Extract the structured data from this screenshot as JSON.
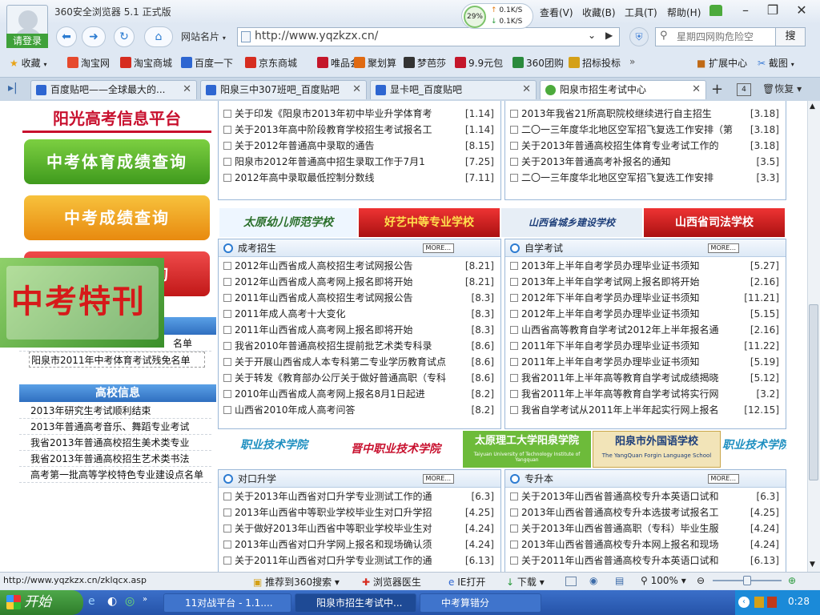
{
  "titlebar": {
    "login": "请登录",
    "title": "360安全浏览器 5.1 正式版",
    "speed": {
      "percent": "29%",
      "up": "0.1K/S",
      "down": "0.1K/S"
    },
    "menus": [
      "查看(V)",
      "收藏(B)",
      "工具(T)",
      "帮助(H)"
    ]
  },
  "nav": {
    "site_label": "网站名片",
    "url": "http://www.yqzkzx.cn/",
    "search_placeholder": "星期四网购危险空",
    "search_button": "搜"
  },
  "bookmarks": {
    "favorites": "收藏",
    "items": [
      "淘宝网",
      "淘宝商城",
      "百度一下",
      "京东商城",
      "唯品会",
      "聚划算",
      "梦芭莎",
      "9.9元包",
      "360团购",
      "招标投标"
    ],
    "colors": [
      "#e6492d",
      "#d62d20",
      "#2e66d1",
      "#d62d20",
      "#c4162a",
      "#e06a12",
      "#333333",
      "#c4162a",
      "#2a8a3c",
      "#d4a017"
    ],
    "extensions": "扩展中心",
    "screenshot": "截图"
  },
  "tabs": [
    {
      "title": "百度贴吧——全球最大的..."
    },
    {
      "title": "阳泉三中307班吧_百度贴吧"
    },
    {
      "title": "显卡吧_百度贴吧"
    },
    {
      "title": "阳泉市招生考试中心"
    }
  ],
  "tabbar": {
    "count": "4",
    "restore": "恢复"
  },
  "left": {
    "logo": "阳光高考信息平台",
    "promos": [
      "中考体育成绩查询",
      "中考成绩查询",
      "中考录取查询"
    ],
    "special": "中考特刊",
    "items_top": [
      "名单",
      "阳泉市2011年中考体育考试残免名单"
    ],
    "section_title": "高校信息",
    "items": [
      "2013年研究生考试顺利结束",
      "2013年普通高考音乐、舞蹈专业考试",
      "我省2013年普通高校招生美术类专业",
      "我省2013年普通高校招生艺术类书法",
      "高考第一批高等学校特色专业建设点名单"
    ]
  },
  "top_left_rows": [
    {
      "t": "关于印发《阳泉市2013年初中毕业升学体育考",
      "d": "[1.14]"
    },
    {
      "t": "关于2013年高中阶段教育学校招生考试报名工",
      "d": "[1.14]"
    },
    {
      "t": "关于2012年普通高中录取的通告",
      "d": "[8.15]"
    },
    {
      "t": "阳泉市2012年普通高中招生录取工作于7月1",
      "d": "[7.25]"
    },
    {
      "t": "2012年高中录取最低控制分数线",
      "d": "[7.11]"
    }
  ],
  "top_right_rows": [
    {
      "t": "2013年我省21所高职院校继续进行自主招生",
      "d": "[3.18]"
    },
    {
      "t": "二〇一三年度华北地区空军招飞复选工作安排（第",
      "d": "[3.18]"
    },
    {
      "t": "关于2013年普通高校招生体育专业考试工作的",
      "d": "[3.18]"
    },
    {
      "t": "关于2013年普通高考补报名的通知",
      "d": "[3.5]"
    },
    {
      "t": "二〇一三年度华北地区空军招飞复选工作安排",
      "d": "[3.3]"
    }
  ],
  "banners_1": [
    "太原幼儿师范学校",
    "好艺中等专业学校",
    "山西省城乡建设学校",
    "山西省司法学校"
  ],
  "panels": {
    "chengkao": {
      "title": "成考招生",
      "more": "MORE...",
      "rows": [
        {
          "t": "2012年山西省成人高校招生考试网报公告",
          "d": "[8.21]"
        },
        {
          "t": "2012年山西省成人高考网上报名即将开始",
          "d": "[8.21]"
        },
        {
          "t": "2011年山西省成人高校招生考试网报公告",
          "d": "[8.3]"
        },
        {
          "t": "2011年成人高考十大变化",
          "d": "[8.3]"
        },
        {
          "t": "2011年山西省成人高考网上报名即将开始",
          "d": "[8.3]"
        },
        {
          "t": "我省2010年普通高校招生提前批艺术类专科录",
          "d": "[8.6]"
        },
        {
          "t": "关于开展山西省成人本专科第二专业学历教育试点",
          "d": "[8.6]"
        },
        {
          "t": "关于转发《教育部办公厅关于做好普通高职（专科",
          "d": "[8.6]"
        },
        {
          "t": "2010年山西省成人高考网上报名8月1日起进",
          "d": "[8.2]"
        },
        {
          "t": "山西省2010年成人高考问答",
          "d": "[8.2]"
        }
      ]
    },
    "zikao": {
      "title": "自学考试",
      "more": "MORE...",
      "rows": [
        {
          "t": "2013年上半年自考学员办理毕业证书须知",
          "d": "[5.27]"
        },
        {
          "t": "2013年上半年自学考试网上报名即将开始",
          "d": "[2.16]"
        },
        {
          "t": "2012年下半年自考学员办理毕业证书须知",
          "d": "[11.21]"
        },
        {
          "t": "2012年上半年自考学员办理毕业证书须知",
          "d": "[5.15]"
        },
        {
          "t": "山西省高等教育自学考试2012年上半年报名通",
          "d": "[2.16]"
        },
        {
          "t": "2011年下半年自考学员办理毕业证书须知",
          "d": "[11.22]"
        },
        {
          "t": "2011年上半年自考学员办理毕业证书须知",
          "d": "[5.19]"
        },
        {
          "t": "我省2011年上半年高等教育自学考试成绩揭晓",
          "d": "[5.12]"
        },
        {
          "t": "我省2011年上半年高等教育自学考试将实行网",
          "d": "[3.2]"
        },
        {
          "t": "我省自学考试从2011年上半年起实行网上报名",
          "d": "[12.15]"
        }
      ]
    },
    "duikou": {
      "title": "对口升学",
      "more": "MORE...",
      "rows": [
        {
          "t": "关于2013年山西省对口升学专业测试工作的通",
          "d": "[6.3]"
        },
        {
          "t": "2013年山西省中等职业学校毕业生对口升学招",
          "d": "[4.25]"
        },
        {
          "t": "关于做好2013年山西省中等职业学校毕业生对",
          "d": "[4.24]"
        },
        {
          "t": "2013年山西省对口升学网上报名和现场确认须",
          "d": "[4.24]"
        },
        {
          "t": "关于2011年山西省对口升学专业测试工作的通",
          "d": "[6.13]"
        }
      ]
    },
    "zhuanshengben": {
      "title": "专升本",
      "more": "MORE...",
      "rows": [
        {
          "t": "关于2013年山西省普通高校专升本英语口试和",
          "d": "[6.3]"
        },
        {
          "t": "2013年山西省普通高校专升本选拔考试报名工",
          "d": "[4.25]"
        },
        {
          "t": "关于2013年山西省普通高职（专科）毕业生服",
          "d": "[4.24]"
        },
        {
          "t": "2013年山西省普通高校专升本网上报名和现场",
          "d": "[4.24]"
        },
        {
          "t": "关于2011年山西省普通高校专升本英语口试和",
          "d": "[6.13]"
        }
      ]
    }
  },
  "banners_2": [
    "职业技术学院",
    "晋中职业技术学院",
    "太原理工大学阳泉学院",
    "阳泉市外国语学校",
    "职业技术学院"
  ],
  "banners_2_sub": {
    "lit": "Taiyuan University of Technology Institute of Yangquan",
    "foreign": "The YangQuan Forgin Language School"
  },
  "status": {
    "link": "http://www.yqzkzx.cn/zklqcx.asp",
    "recommend": "推荐到360搜索",
    "doctor": "浏览器医生",
    "ie": "IE打开",
    "download": "下载",
    "zoom": "100%"
  },
  "taskbar": {
    "start": "开始",
    "tasks": [
      "11对战平台 - 1.1....",
      "阳泉市招生考试中...",
      "中考算错分"
    ],
    "time": "0:28"
  }
}
